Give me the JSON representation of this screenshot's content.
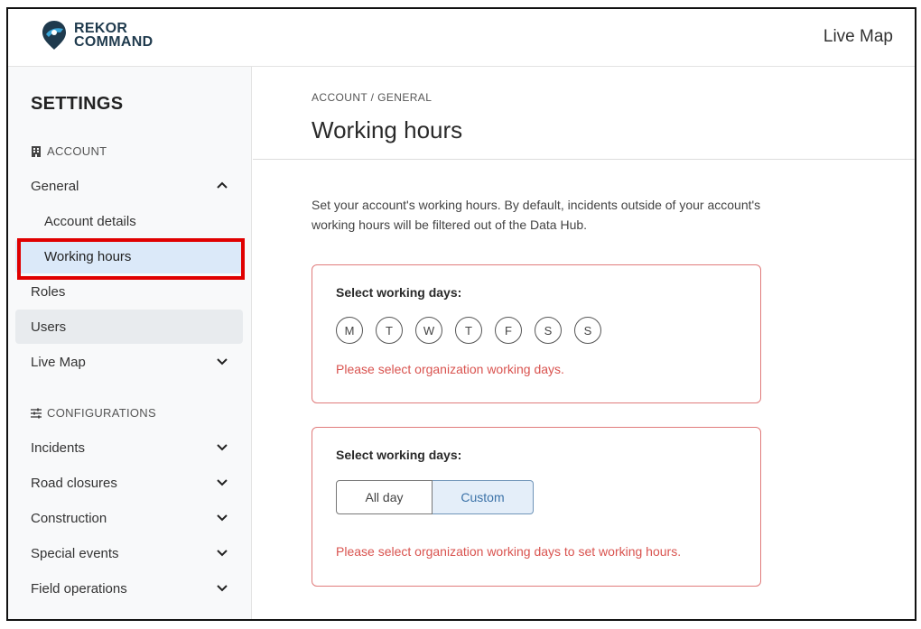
{
  "header": {
    "logo_line1": "REKOR",
    "logo_line2": "COMMAND",
    "live_map_label": "Live Map"
  },
  "sidebar": {
    "title": "SETTINGS",
    "account_label": "ACCOUNT",
    "configurations_label": "CONFIGURATIONS",
    "items": {
      "general": "General",
      "account_details": "Account details",
      "working_hours": "Working hours",
      "roles": "Roles",
      "users": "Users",
      "live_map": "Live Map",
      "incidents": "Incidents",
      "road_closures": "Road closures",
      "construction": "Construction",
      "special_events": "Special events",
      "field_operations": "Field operations"
    }
  },
  "main": {
    "breadcrumb": "ACCOUNT / GENERAL",
    "title": "Working hours",
    "description": "Set your account's working hours. By default, incidents outside of your account's working hours will be filtered out of the Data Hub.",
    "card1": {
      "title": "Select working days:",
      "days": [
        "M",
        "T",
        "W",
        "T",
        "F",
        "S",
        "S"
      ],
      "error": "Please select organization working days."
    },
    "card2": {
      "title": "Select working days:",
      "all_day_label": "All day",
      "custom_label": "Custom",
      "selected": "Custom",
      "error": "Please select organization working days to set working hours."
    }
  },
  "colors": {
    "accent": "#3b72a8",
    "selected_bg": "#dbe9f9",
    "error": "#d9534f",
    "annotation_box": "#e00000"
  }
}
